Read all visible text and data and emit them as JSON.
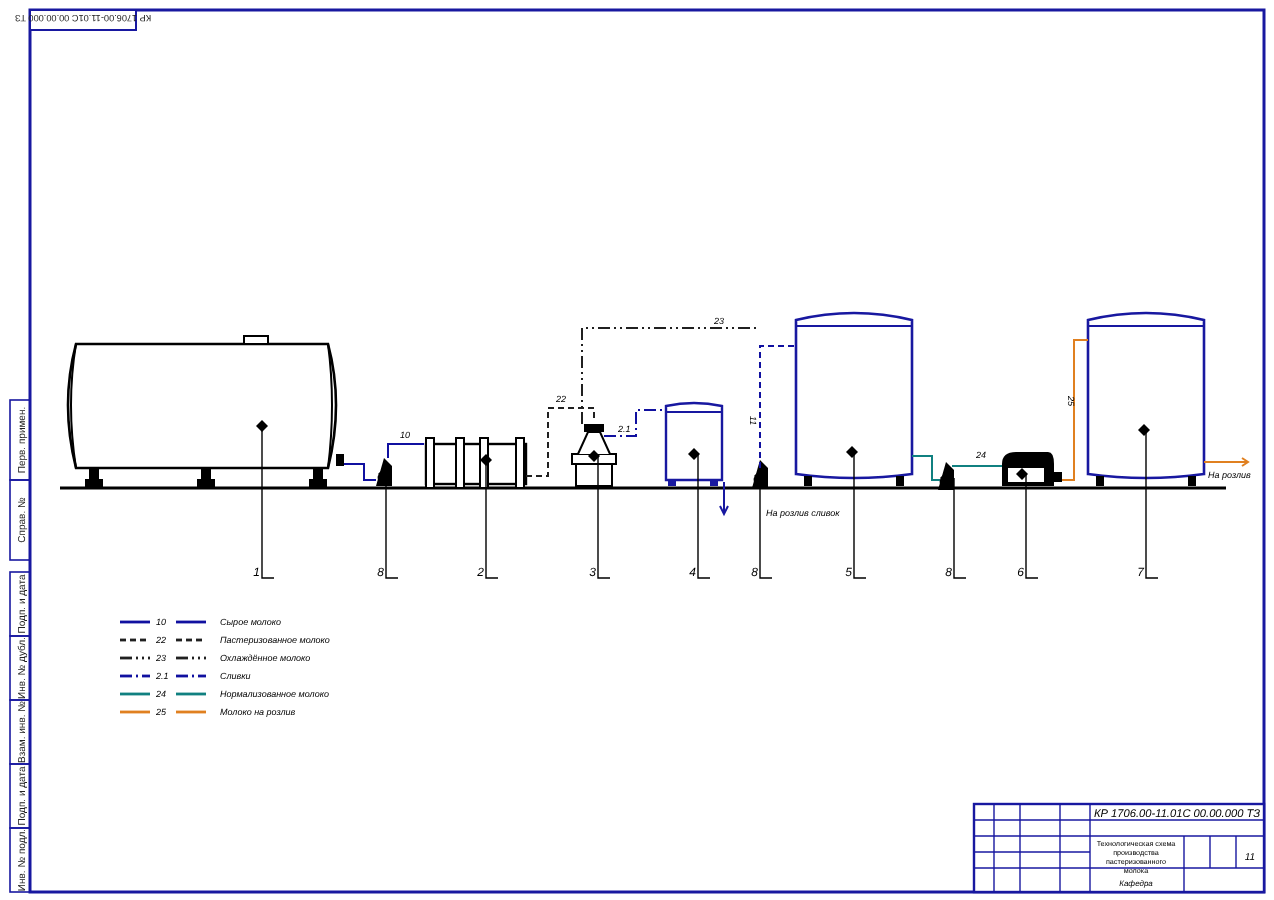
{
  "stamp": "КР 1706.00-11.01С 00.00.000 ТЗ",
  "equipment": [
    {
      "kind": "horizontal-tank",
      "number": "1"
    },
    {
      "kind": "pump",
      "number": "8"
    },
    {
      "kind": "cooler",
      "number": "2"
    },
    {
      "kind": "separator",
      "number": "3"
    },
    {
      "kind": "small-tank",
      "number": "4"
    },
    {
      "kind": "pump",
      "number": "8"
    },
    {
      "kind": "vertical-tank",
      "number": "5"
    },
    {
      "kind": "pump",
      "number": "8"
    },
    {
      "kind": "plate-unit",
      "number": "6"
    },
    {
      "kind": "vertical-tank",
      "number": "7"
    }
  ],
  "pipes": [
    {
      "kind": "solid",
      "color": "#1010a0",
      "label": "10"
    },
    {
      "kind": "dashed",
      "color": "#202020",
      "label": "22"
    },
    {
      "kind": "dash-dot",
      "color": "#1010a0",
      "label": "2.1"
    },
    {
      "kind": "dash-dot-dot",
      "color": "#202020",
      "label": "23"
    },
    {
      "kind": "dashed",
      "color": "#1010a0",
      "label": "11"
    },
    {
      "kind": "solid",
      "color": "#108080",
      "label": "24"
    },
    {
      "kind": "solid",
      "color": "#e08020",
      "label": "25"
    }
  ],
  "outlets": [
    "На розлив сливок",
    "На розлив"
  ],
  "legend": [
    {
      "kind": "solid",
      "color": "#1010a0",
      "code": "10",
      "text": "Сырое молоко"
    },
    {
      "kind": "dashed",
      "color": "#202020",
      "code": "22",
      "text": "Пастеризованное молоко"
    },
    {
      "kind": "dash-dot-dot",
      "color": "#202020",
      "code": "23",
      "text": "Охлаждённое молоко"
    },
    {
      "kind": "dash-dot",
      "color": "#1010a0",
      "code": "2.1",
      "text": "Сливки"
    },
    {
      "kind": "solid",
      "color": "#108080",
      "code": "24",
      "text": "Нормализованное молоко"
    },
    {
      "kind": "solid",
      "color": "#e08020",
      "code": "25",
      "text": "Молоко на розлив"
    }
  ],
  "title_block": {
    "code": "КР 1706.00-11.01С 00.00.000 ТЗ",
    "title": "Технологическая схема производства пастеризованного молока",
    "sheet": "11",
    "department": "Кафедра"
  },
  "side_strip": [
    "Перв. примен.",
    "Справ. №",
    "Подп. и дата",
    "Инв. № дубл.",
    "Взам. инв. №",
    "Подп. и дата",
    "Инв. № подл."
  ]
}
